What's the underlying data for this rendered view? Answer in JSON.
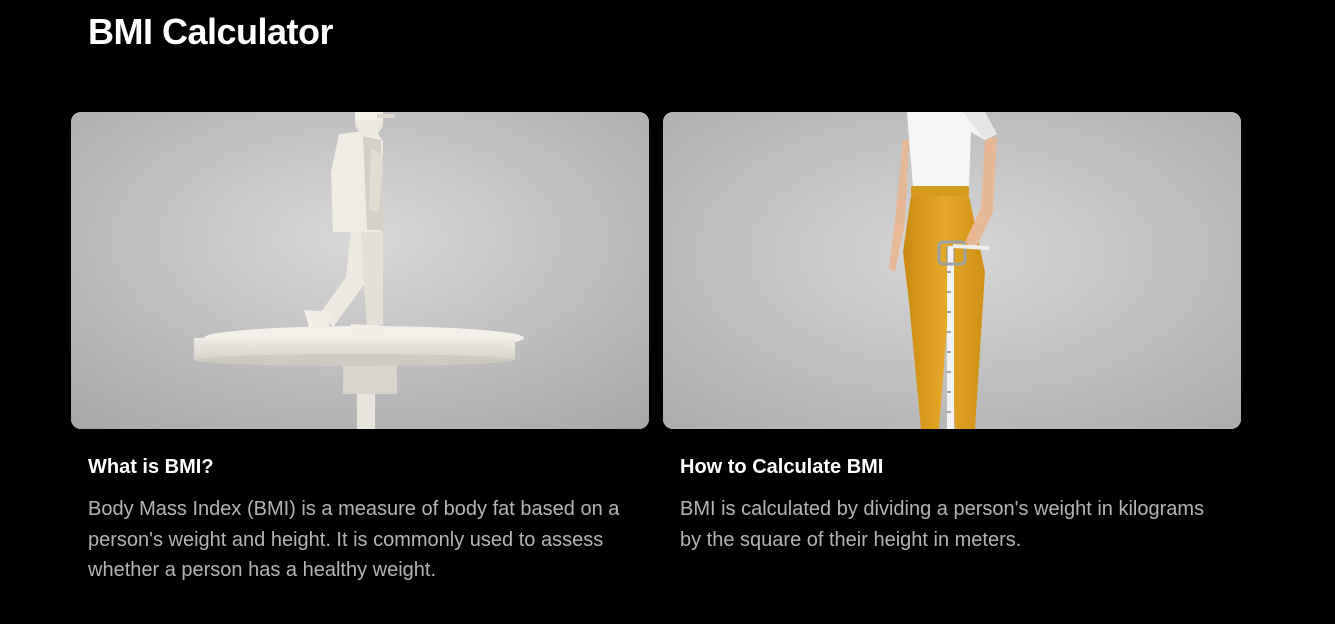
{
  "page": {
    "title": "BMI Calculator"
  },
  "cards": [
    {
      "heading": "What is BMI?",
      "body": "Body Mass Index (BMI) is a measure of body fat based on a person's weight and height. It is commonly used to assess whether a person has a healthy weight.",
      "image": "white-figure-walking-on-pedestal-illustration"
    },
    {
      "heading": "How to Calculate BMI",
      "body": "BMI is calculated by dividing a person's weight in kilograms by the square of their height in meters.",
      "image": "woman-with-measuring-tape-illustration"
    }
  ],
  "colors": {
    "background": "#000000",
    "heading_text": "#ffffff",
    "body_text": "#b4b4b4",
    "pants": "#e3a21f"
  }
}
